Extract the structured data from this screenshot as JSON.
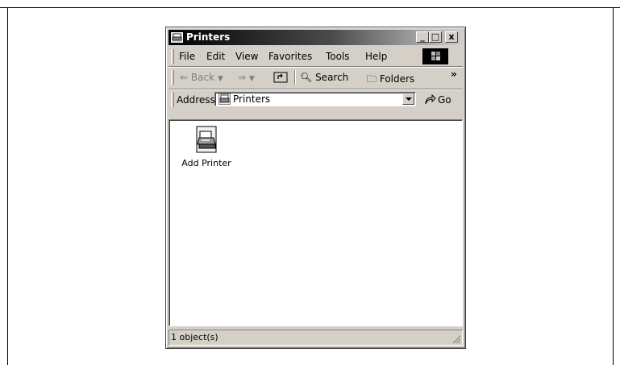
{
  "window": {
    "title": "Printers",
    "controls": {
      "minimize": "_",
      "maximize": "□",
      "close": "x"
    }
  },
  "menu": {
    "items": [
      "File",
      "Edit",
      "View",
      "Favorites",
      "Tools",
      "Help"
    ]
  },
  "toolbar": {
    "back_label": "Back",
    "search_label": "Search",
    "folders_label": "Folders",
    "more_glyph": "»"
  },
  "address": {
    "label": "Address",
    "value": "Printers",
    "go_label": "Go"
  },
  "content": {
    "items": [
      {
        "label": "Add Printer",
        "icon": "add-printer-icon"
      }
    ]
  },
  "status": {
    "text": "1 object(s)"
  },
  "colors": {
    "face": "#d4d0c8",
    "title_start": "#000000",
    "title_end": "#cfcfcf"
  }
}
